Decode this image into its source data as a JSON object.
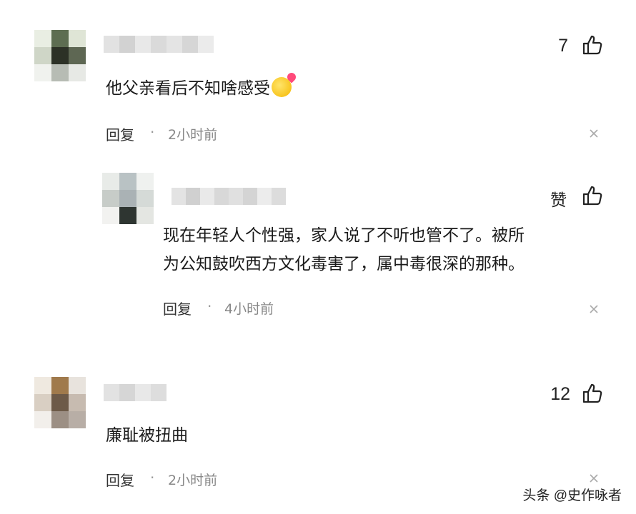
{
  "comments": [
    {
      "text": "他父亲看后不知啥感受",
      "emoji": "face-with-kiss-emoji",
      "likes": "7",
      "reply_label": "回复",
      "separator": "·",
      "time": "2小时前"
    },
    {
      "text_lines": [
        "现在年轻人个性强，家人说了不听也管不了。被所",
        "为公知鼓吹西方文化毒害了，属中毒很深的那种。"
      ],
      "likes": "赞",
      "reply_label": "回复",
      "separator": "·",
      "time": "4小时前"
    },
    {
      "text": "廉耻被扭曲",
      "likes": "12",
      "reply_label": "回复",
      "separator": "·",
      "time": "2小时前"
    }
  ],
  "watermark": "头条 @史作咏者",
  "colors": {
    "text": "#1a1a1a",
    "muted": "#888888",
    "background": "#ffffff"
  }
}
